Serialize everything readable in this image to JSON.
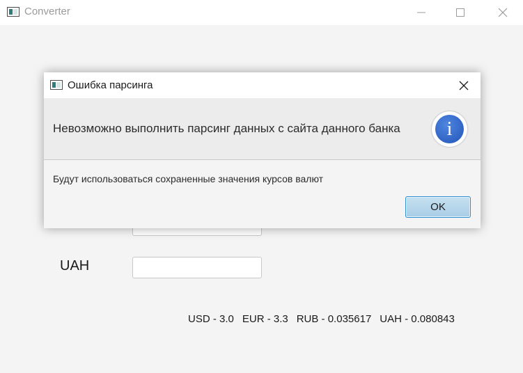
{
  "window": {
    "title": "Converter"
  },
  "form": {
    "uah_label": "UAH",
    "uah_value": "",
    "hidden_field_value": ""
  },
  "rates": {
    "usd": "USD - 3.0",
    "eur": "EUR - 3.3",
    "rub": "RUB - 0.035617",
    "uah": "UAH - 0.080843"
  },
  "dialog": {
    "title": "Ошибка парсинга",
    "header_text": "Невозможно выполнить парсинг данных с сайта данного банка",
    "content_text": "Будут использоваться сохраненные значения курсов валют",
    "ok_label": "OK",
    "icon": "info-icon",
    "icon_glyph": "i"
  },
  "colors": {
    "accent": "#2f63c4",
    "ok_border": "#2f8dcf",
    "window_bg": "#f4f4f4"
  }
}
